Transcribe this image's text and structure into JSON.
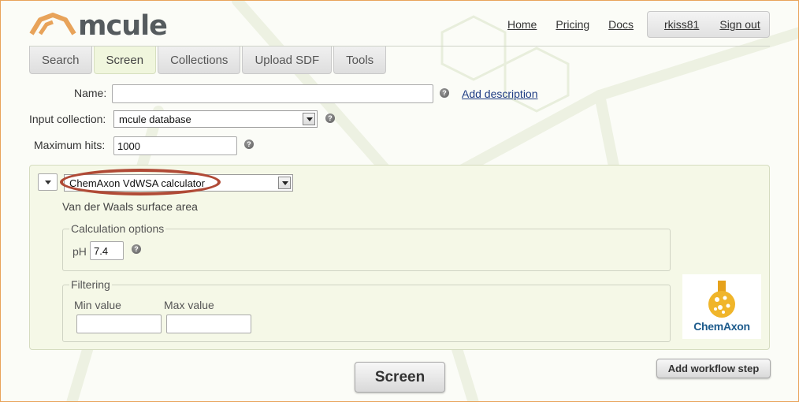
{
  "header": {
    "logo_text": "mcule",
    "nav": [
      "Home",
      "Pricing",
      "Docs"
    ],
    "user": "rkiss81",
    "signout": "Sign out"
  },
  "tabs": [
    {
      "label": "Search",
      "active": false
    },
    {
      "label": "Screen",
      "active": true
    },
    {
      "label": "Collections",
      "active": false
    },
    {
      "label": "Upload SDF",
      "active": false
    },
    {
      "label": "Tools",
      "active": false
    }
  ],
  "form": {
    "name_label": "Name:",
    "name_value": "",
    "add_description": "Add description",
    "input_collection_label": "Input collection:",
    "input_collection_value": "mcule database",
    "max_hits_label": "Maximum hits:",
    "max_hits_value": "1000",
    "help_glyph": "?"
  },
  "workflow": {
    "calculator": "ChemAxon VdWSA calculator",
    "description": "Van der Waals surface area",
    "calc_options_legend": "Calculation options",
    "ph_label": "pH",
    "ph_value": "7.4",
    "filtering_legend": "Filtering",
    "min_label": "Min value",
    "max_label": "Max value",
    "min_value": "",
    "max_value": "",
    "logo_text": "ChemAxon"
  },
  "buttons": {
    "screen": "Screen",
    "add_step": "Add workflow step"
  },
  "colors": {
    "accent_orange": "#e8a35a",
    "panel_bg": "#f5f8e7",
    "highlight_ellipse": "#b04a36",
    "link_blue": "#1d3b83"
  }
}
